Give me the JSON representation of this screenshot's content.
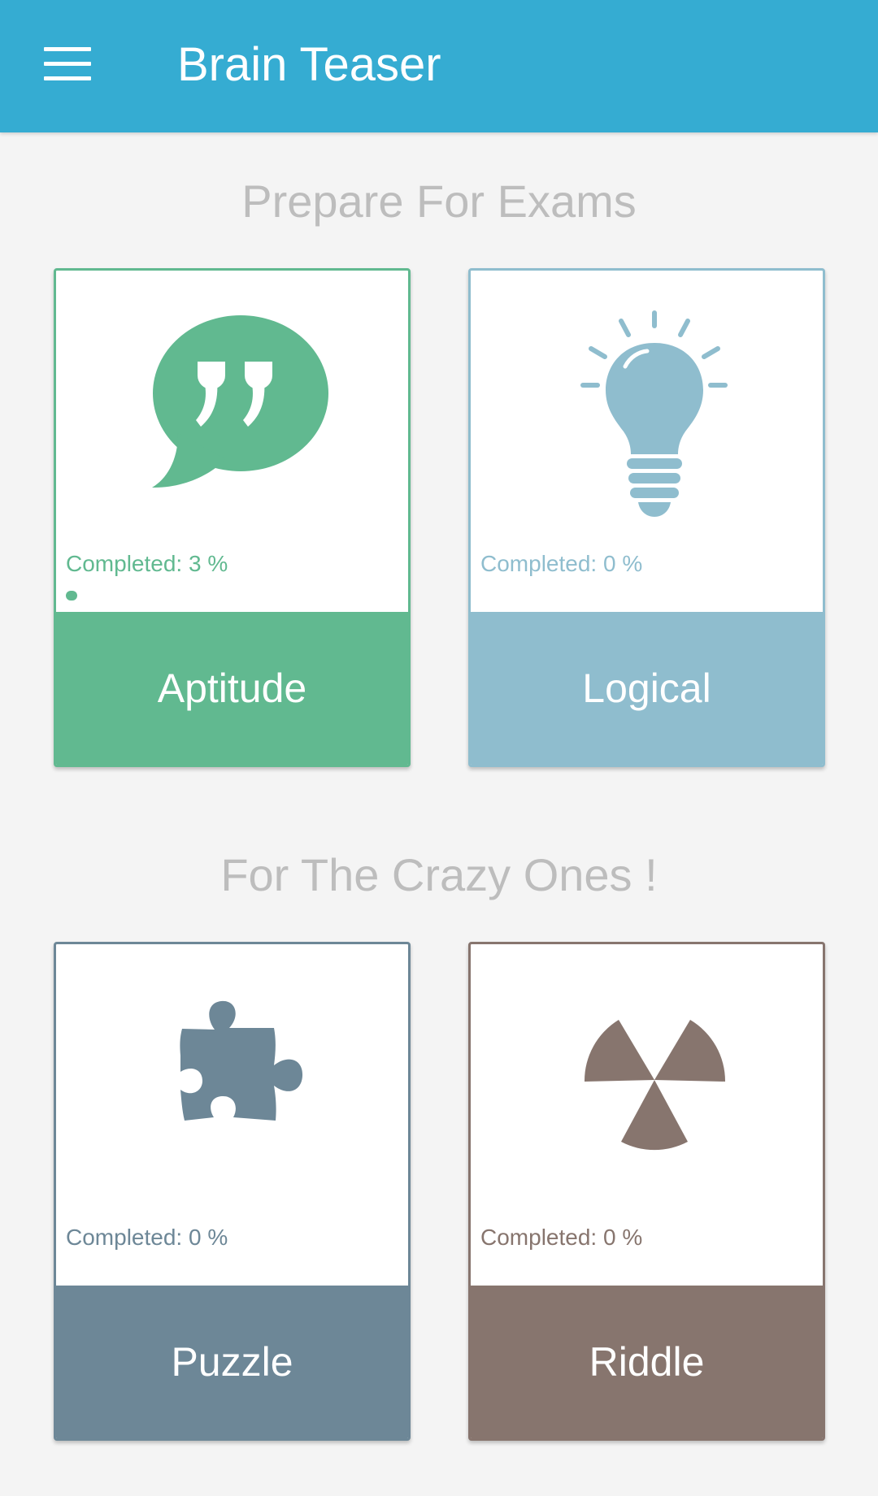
{
  "appbar": {
    "title": "Brain Teaser",
    "menu_icon": "hamburger-menu-icon",
    "background": "#35acd2"
  },
  "sections": [
    {
      "title": "Prepare For Exams",
      "cards": [
        {
          "label": "Aptitude",
          "completed_text": "Completed: 3 %",
          "progress_percent": 3,
          "icon": "quote-bubble-icon",
          "color": "#61b990"
        },
        {
          "label": "Logical",
          "completed_text": "Completed: 0 %",
          "progress_percent": 0,
          "icon": "lightbulb-icon",
          "color": "#8fbdce"
        }
      ]
    },
    {
      "title": "For The Crazy Ones !",
      "cards": [
        {
          "label": "Puzzle",
          "completed_text": "Completed: 0 %",
          "progress_percent": 0,
          "icon": "puzzle-piece-icon",
          "color": "#6d8797"
        },
        {
          "label": "Riddle",
          "completed_text": "Completed: 0 %",
          "progress_percent": 0,
          "icon": "radiation-icon",
          "color": "#87756e"
        }
      ]
    }
  ]
}
